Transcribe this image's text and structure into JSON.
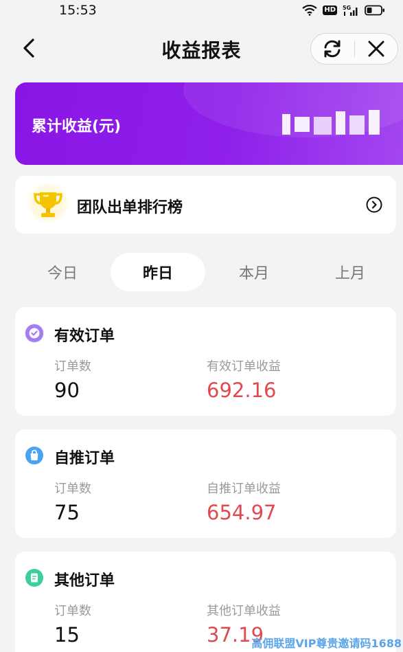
{
  "status": {
    "time": "15:53",
    "hd": "HD",
    "network": "5G"
  },
  "nav": {
    "title": "收益报表"
  },
  "earnings": {
    "label": "累计收益(元)"
  },
  "ranking": {
    "title": "团队出单排行榜"
  },
  "tabs": [
    {
      "label": "今日",
      "active": false
    },
    {
      "label": "昨日",
      "active": true
    },
    {
      "label": "本月",
      "active": false
    },
    {
      "label": "上月",
      "active": false
    }
  ],
  "orders": [
    {
      "title": "有效订单",
      "count_label": "订单数",
      "count": "90",
      "income_label": "有效订单收益",
      "income": "692.16",
      "icon": "check-badge-icon",
      "icon_color": "#9b6bf0"
    },
    {
      "title": "自推订单",
      "count_label": "订单数",
      "count": "75",
      "income_label": "自推订单收益",
      "income": "654.97",
      "icon": "shopping-bag-icon",
      "icon_color": "#4aa3f0"
    },
    {
      "title": "其他订单",
      "count_label": "订单数",
      "count": "15",
      "income_label": "其他订单收益",
      "income": "37.19",
      "icon": "document-icon",
      "icon_color": "#3ccf9a"
    }
  ],
  "watermark": "高佣联盟VIP尊贵邀请码1688",
  "colors": {
    "accent_purple": "#8a16e6",
    "income_red": "#e04a4f",
    "background": "#f2f3f5"
  }
}
